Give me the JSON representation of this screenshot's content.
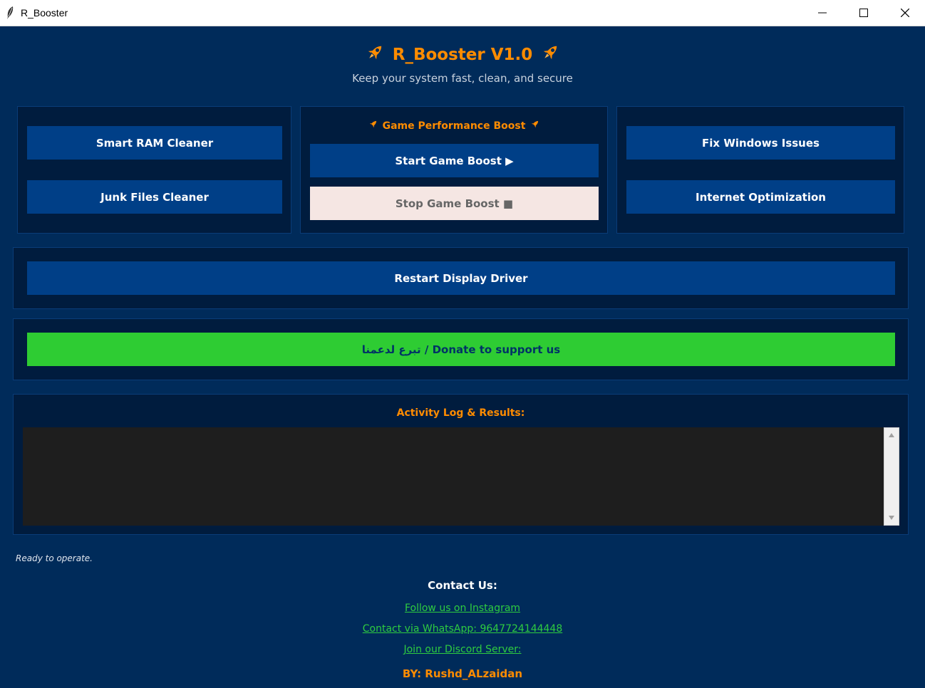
{
  "window": {
    "title": "R_Booster",
    "icon": "feather-icon",
    "controls": [
      "minimize-icon",
      "maximize-icon",
      "close-icon"
    ]
  },
  "header": {
    "title": "R_Booster V1.0",
    "subtitle": "Keep your system fast, clean, and secure",
    "icon": "rocket-icon"
  },
  "left_panel": {
    "smart_ram": "Smart RAM Cleaner",
    "junk_files": "Junk Files Cleaner"
  },
  "game_panel": {
    "title": "Game Performance Boost",
    "start": "Start Game Boost ▶",
    "stop": "Stop Game Boost ■"
  },
  "right_panel": {
    "fix_windows": "Fix Windows Issues",
    "internet": "Internet Optimization"
  },
  "display_driver": {
    "label": "Restart Display Driver"
  },
  "donate": {
    "label": "تبرع لدعمنا / Donate to support us"
  },
  "log": {
    "title": "Activity Log & Results:",
    "content": ""
  },
  "status": "Ready to operate.",
  "contact": {
    "title": "Contact Us:",
    "instagram": "Follow us on Instagram",
    "whatsapp": "Contact via WhatsApp: 9647724144448",
    "discord": "Join our Discord Server:"
  },
  "byline": "BY: Rushd_ALzaidan",
  "colors": {
    "background": "#002b5a",
    "panel": "#001c3e",
    "button": "#003f87",
    "accent": "#ff8c00",
    "donate": "#2ecc33",
    "link": "#2ecc40"
  }
}
